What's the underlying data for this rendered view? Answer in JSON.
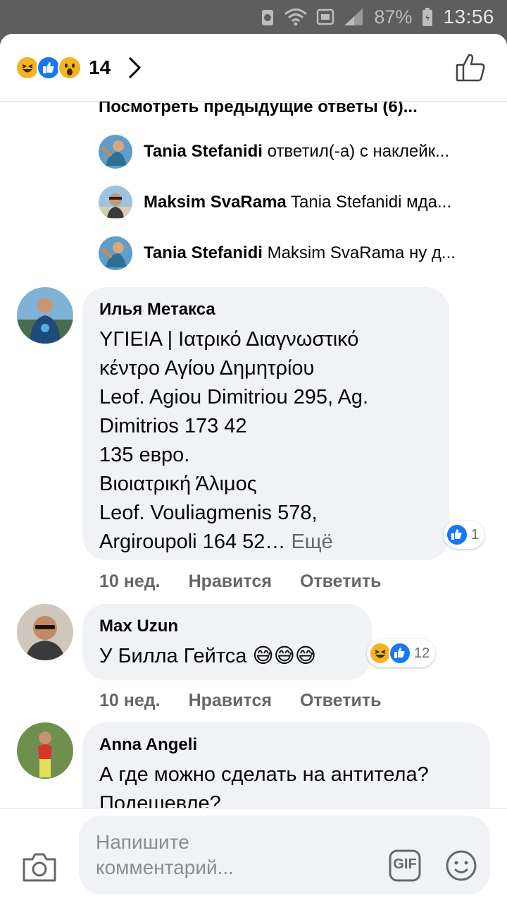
{
  "status_bar": {
    "battery_pct": "87%",
    "time": "13:56",
    "icons": [
      "recycle-icon",
      "wifi-icon",
      "hd-icon",
      "signal-icon",
      "battery-icon"
    ]
  },
  "header": {
    "reactions": [
      "haha",
      "like",
      "wow"
    ],
    "reaction_count": "14",
    "chevron_icon": "chevron-right-icon",
    "like_icon": "thumbs-up-icon"
  },
  "prev_replies_link": "Посмотреть предыдущие ответы (6)...",
  "replies": [
    {
      "author": "Tania Stefanidi",
      "text": "ответил(-а) с наклейк..."
    },
    {
      "author": "Maksim SvaRama",
      "text": "Tania Stefanidi мда..."
    },
    {
      "author": "Tania Stefanidi",
      "text": "Maksim SvaRama ну д..."
    }
  ],
  "comments": [
    {
      "author": "Илья Метакса",
      "body": "ΥΓΙΕΙΑ | Ιατρικό Διαγνωστικό\nκέντρο Αγίου Δημητρίου\nLeof. Agiou Dimitriou 295, Ag.\nDimitrios 173 42\n135 евро.\nΒιοιατρική Άλιμος\nLeof. Vouliagmenis 578,\nArgiroupoli 164 52…",
      "more": " Ещё",
      "reaction_count": "1",
      "time": "10 нед.",
      "like_label": "Нравится",
      "reply_label": "Ответить"
    },
    {
      "author": "Max Uzun",
      "body": "У Билла Гейтса 😅😅😅",
      "reaction_count": "12",
      "time": "10 нед.",
      "like_label": "Нравится",
      "reply_label": "Ответить"
    },
    {
      "author": "Anna Angeli",
      "body": "А где можно сделать на антитела?\nПодешевле?"
    }
  ],
  "composer": {
    "placeholder": "Напишите комментарий...",
    "gif_label": "GIF"
  },
  "colors": {
    "like_blue": "#1877f2",
    "bubble_bg": "#f0f2f5",
    "secondary_text": "#65676b",
    "haha_yellow": "#f7b125"
  }
}
